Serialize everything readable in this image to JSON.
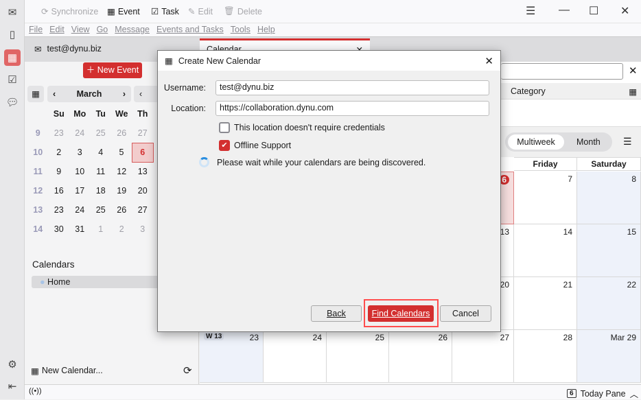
{
  "toolbar": {
    "synchronize": "Synchronize",
    "event": "Event",
    "task": "Task",
    "edit": "Edit",
    "delete": "Delete"
  },
  "menu": [
    "File",
    "Edit",
    "View",
    "Go",
    "Message",
    "Events and Tasks",
    "Tools",
    "Help"
  ],
  "account_tab": "test@dynu.biz",
  "calendar_tab": "Calendar",
  "new_event": "New Event",
  "mini_calendar": {
    "month": "March",
    "weekdays": [
      "Su",
      "Mo",
      "Tu",
      "We",
      "Th"
    ],
    "weeks": [
      {
        "wk": "9",
        "days": [
          "23",
          "24",
          "25",
          "26",
          "27"
        ],
        "other": [
          0,
          1,
          2,
          3,
          4
        ]
      },
      {
        "wk": "10",
        "days": [
          "2",
          "3",
          "4",
          "5",
          "6"
        ],
        "other": []
      },
      {
        "wk": "11",
        "days": [
          "9",
          "10",
          "11",
          "12",
          "13"
        ],
        "other": []
      },
      {
        "wk": "12",
        "days": [
          "16",
          "17",
          "18",
          "19",
          "20"
        ],
        "other": []
      },
      {
        "wk": "13",
        "days": [
          "23",
          "24",
          "25",
          "26",
          "27"
        ],
        "other": []
      },
      {
        "wk": "14",
        "days": [
          "30",
          "31",
          "1",
          "2",
          "3"
        ],
        "other": [
          2,
          3,
          4
        ]
      }
    ],
    "today": "6"
  },
  "calendars_heading": "Calendars",
  "calendars": [
    {
      "name": "Home",
      "color": "#a8c4e6"
    }
  ],
  "new_calendar": "New Calendar...",
  "search_header": {
    "category": "Category"
  },
  "view_switch": {
    "multiweek": "Multiweek",
    "month": "Month",
    "selected": "Multiweek"
  },
  "main_calendar": {
    "headers": [
      "Friday",
      "Saturday"
    ],
    "rows": [
      [
        "",
        "",
        "",
        "",
        "6",
        "7",
        "8"
      ],
      [
        "",
        "",
        "",
        "",
        "13",
        "14",
        "15"
      ],
      [
        "",
        "",
        "",
        "",
        "20",
        "21",
        "22"
      ],
      [
        "23",
        "24",
        "25",
        "26",
        "27",
        "28",
        "Mar 29"
      ]
    ],
    "week_label": "W 13",
    "today": "6"
  },
  "today_pane": {
    "label": "Today Pane",
    "day": "6"
  },
  "dialog": {
    "title": "Create New Calendar",
    "username_label": "Username:",
    "username": "test@dynu.biz",
    "location_label": "Location:",
    "location": "https://collaboration.dynu.com",
    "no_credentials": "This location doesn't require credentials",
    "no_credentials_checked": false,
    "offline": "Offline Support",
    "offline_checked": true,
    "status": "Please wait while your calendars are being discovered.",
    "back": "Back",
    "find": "Find Calendars",
    "cancel": "Cancel"
  },
  "colors": {
    "accent": "#d32f2f",
    "highlight": "#ff4d4d"
  }
}
